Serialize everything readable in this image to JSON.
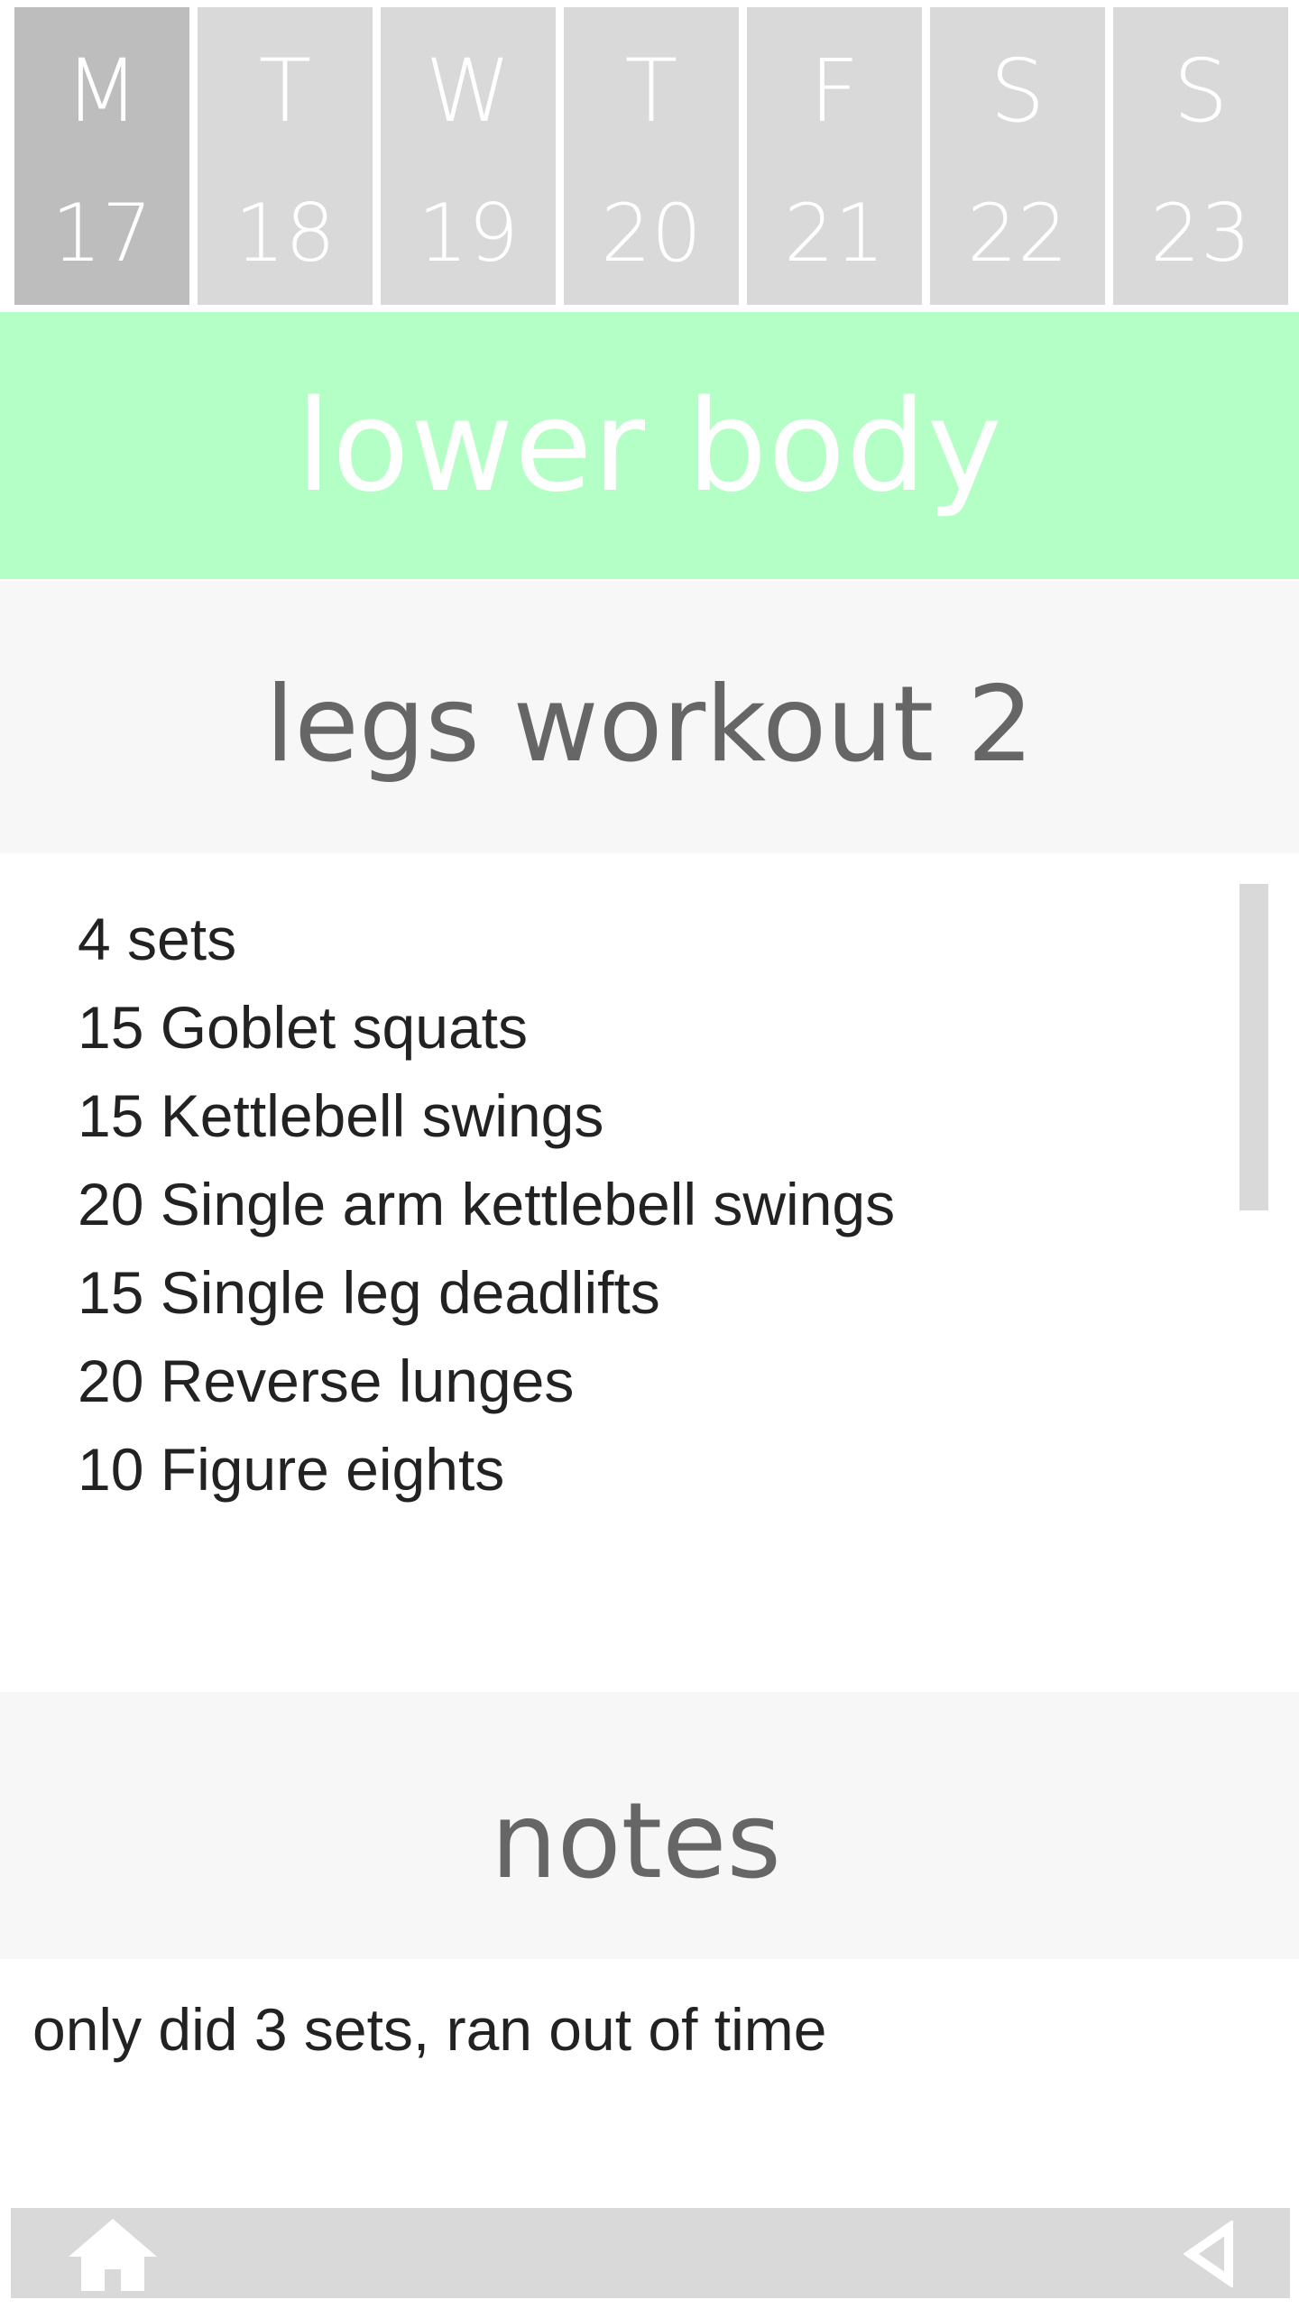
{
  "week": {
    "days": [
      {
        "letter": "M",
        "date": "17",
        "selected": true
      },
      {
        "letter": "T",
        "date": "18"
      },
      {
        "letter": "W",
        "date": "19"
      },
      {
        "letter": "T",
        "date": "20"
      },
      {
        "letter": "F",
        "date": "21"
      },
      {
        "letter": "S",
        "date": "22"
      },
      {
        "letter": "S",
        "date": "23"
      }
    ]
  },
  "banner": {
    "title": "lower body",
    "color": "#b4ffc6"
  },
  "workout": {
    "title": "legs workout 2",
    "exercises": [
      "4 sets",
      "15 Goblet squats",
      "15 Kettlebell swings",
      "20 Single arm kettlebell swings",
      "15 Single leg deadlifts",
      "20 Reverse lunges",
      "10 Figure eights"
    ]
  },
  "notes": {
    "title": "notes",
    "text": "only did 3 sets, ran out of time"
  },
  "bottom_bar": {
    "left_icon": "home-icon",
    "right_icon": "back-triangle-icon"
  }
}
